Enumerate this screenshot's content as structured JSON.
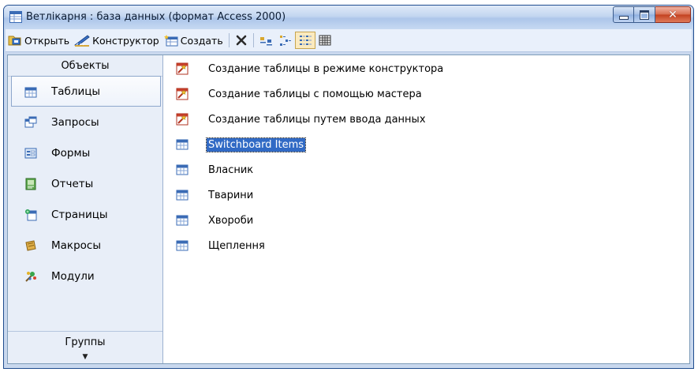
{
  "window": {
    "title": "Ветлікарня : база данных (формат Access 2000)"
  },
  "toolbar": {
    "open_label": "Открыть",
    "design_label": "Конструктор",
    "create_label": "Создать"
  },
  "objects": {
    "header": "Объекты",
    "items": [
      {
        "label": "Таблицы",
        "icon": "table-icon"
      },
      {
        "label": "Запросы",
        "icon": "query-icon"
      },
      {
        "label": "Формы",
        "icon": "form-icon"
      },
      {
        "label": "Отчеты",
        "icon": "report-icon"
      },
      {
        "label": "Страницы",
        "icon": "page-icon"
      },
      {
        "label": "Макросы",
        "icon": "macro-icon"
      },
      {
        "label": "Модули",
        "icon": "module-icon"
      }
    ],
    "selected": "Таблицы",
    "groups_header": "Группы",
    "expand_glyph": "▼"
  },
  "items": [
    {
      "label": "Создание таблицы в режиме конструктора",
      "icon": "wizard-icon"
    },
    {
      "label": "Создание таблицы с помощью мастера",
      "icon": "wizard-icon"
    },
    {
      "label": "Создание таблицы путем ввода данных",
      "icon": "wizard-icon"
    },
    {
      "label": "Switchboard Items",
      "icon": "table-icon",
      "selected": true
    },
    {
      "label": "Власник",
      "icon": "table-icon"
    },
    {
      "label": "Тварини",
      "icon": "table-icon"
    },
    {
      "label": "Хвороби",
      "icon": "table-icon"
    },
    {
      "label": "Щеплення",
      "icon": "table-icon"
    }
  ],
  "colors": {
    "selection": "#316ac5",
    "title_bar": "#c3d6f0",
    "panel": "#e8eef8",
    "close_button": "#c2401f"
  }
}
